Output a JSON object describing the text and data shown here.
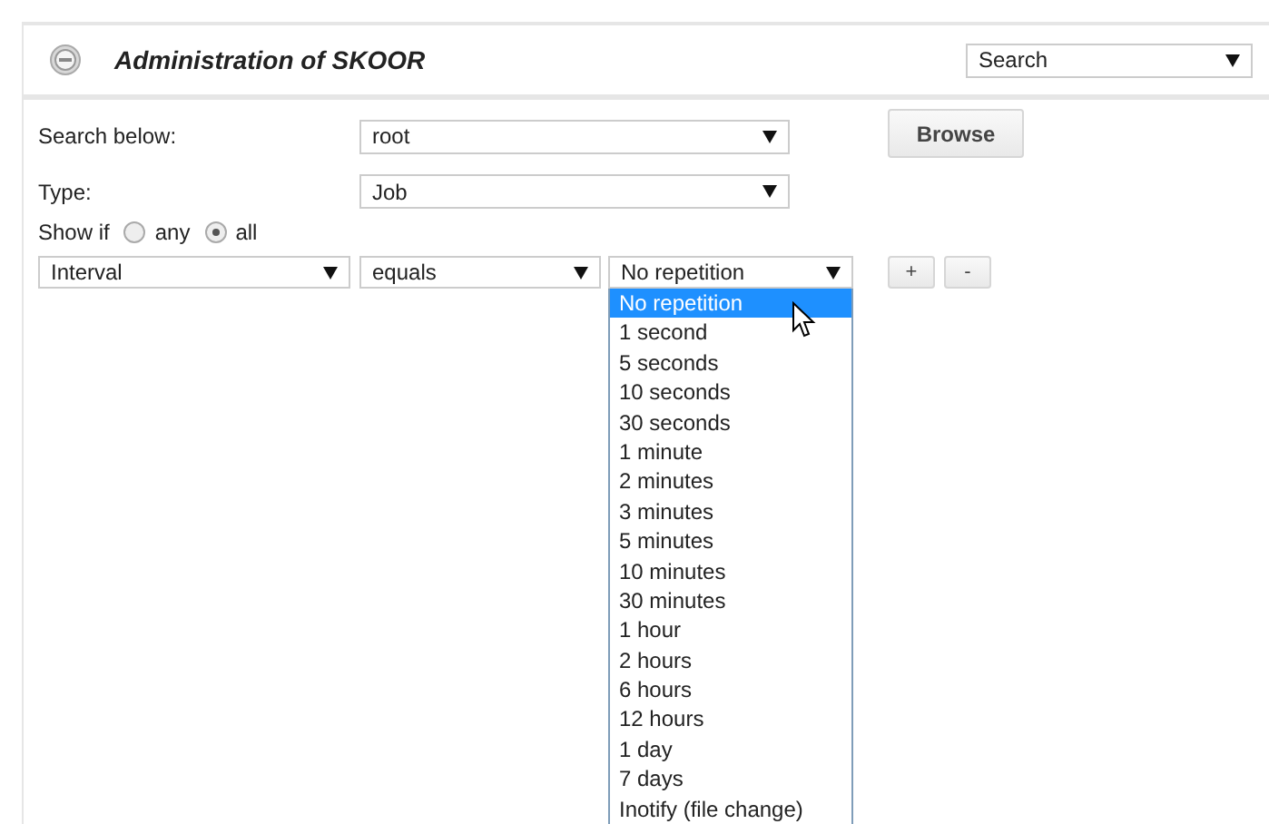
{
  "header": {
    "title": "Administration of SKOOR",
    "mode_select": "Search"
  },
  "form": {
    "search_below": {
      "label": "Search below:",
      "value": "root"
    },
    "browse_button": "Browse",
    "type": {
      "label": "Type:",
      "value": "Job"
    },
    "show_if": {
      "label": "Show if",
      "options": [
        {
          "label": "any",
          "selected": false
        },
        {
          "label": "all",
          "selected": true
        }
      ]
    }
  },
  "condition": {
    "field": "Interval",
    "operator": "equals",
    "value": "No repetition",
    "add_button": "+",
    "remove_button": "-"
  },
  "dropdown": {
    "expanded": true,
    "options": [
      {
        "label": "No repetition",
        "selected": true
      },
      {
        "label": "1 second",
        "selected": false
      },
      {
        "label": "5 seconds",
        "selected": false
      },
      {
        "label": "10 seconds",
        "selected": false
      },
      {
        "label": "30 seconds",
        "selected": false
      },
      {
        "label": "1 minute",
        "selected": false
      },
      {
        "label": "2 minutes",
        "selected": false
      },
      {
        "label": "3 minutes",
        "selected": false
      },
      {
        "label": "5 minutes",
        "selected": false
      },
      {
        "label": "10 minutes",
        "selected": false
      },
      {
        "label": "30 minutes",
        "selected": false
      },
      {
        "label": "1 hour",
        "selected": false
      },
      {
        "label": "2 hours",
        "selected": false
      },
      {
        "label": "6 hours",
        "selected": false
      },
      {
        "label": "12 hours",
        "selected": false
      },
      {
        "label": "1 day",
        "selected": false
      },
      {
        "label": "7 days",
        "selected": false
      },
      {
        "label": "Inotify (file change)",
        "selected": false
      }
    ]
  }
}
